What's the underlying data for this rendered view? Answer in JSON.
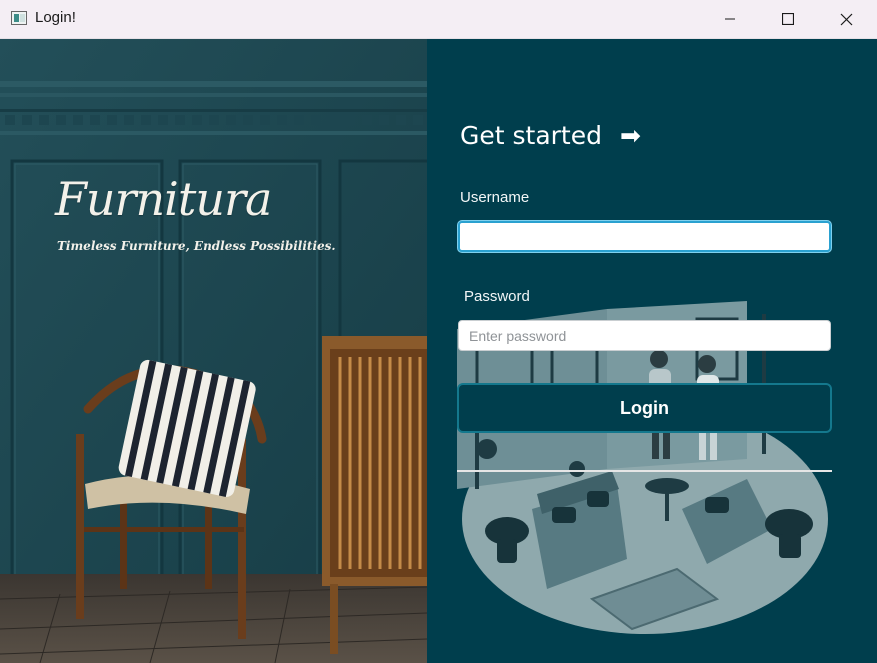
{
  "window": {
    "title": "Login!",
    "app_icon": "app-window-icon",
    "controls": [
      "minimize-icon",
      "maximize-icon",
      "close-icon"
    ]
  },
  "hero": {
    "brand": "Furnitura",
    "tagline": "Timeless Furniture, Endless Possibilities."
  },
  "form": {
    "heading": "Get started",
    "heading_icon": "➡",
    "username_label": "Username",
    "username_value": "",
    "password_label": "Password",
    "password_placeholder": "Enter password",
    "login_label": "Login"
  },
  "colors": {
    "panel_bg": "#003e4d",
    "wall": "#1b4751",
    "focus_border": "#2aa1d0",
    "button_border": "#14788d"
  }
}
